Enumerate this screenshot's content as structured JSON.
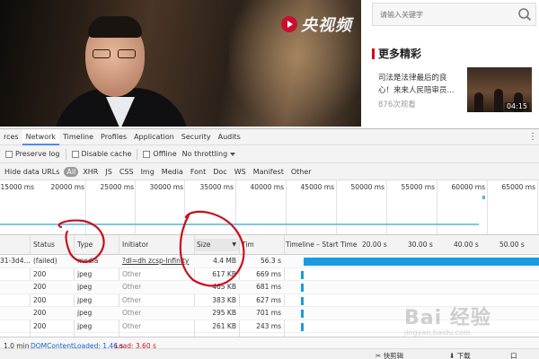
{
  "video": {
    "logo_text": "央视频"
  },
  "search": {
    "placeholder": "请输入关键字"
  },
  "recommend": {
    "section_title": "更多精彩",
    "item_title": "司法是法律最后的良心！来来人民陪审员...",
    "views": "876次观看",
    "duration": "04:15"
  },
  "devtools": {
    "tabs": [
      "rces",
      "Network",
      "Timeline",
      "Profiles",
      "Application",
      "Security",
      "Audits"
    ],
    "active_tab": "Network",
    "toolbar": {
      "preserve_log": "Preserve log",
      "disable_cache": "Disable cache",
      "offline": "Offline",
      "throttling": "No throttling"
    },
    "filters": [
      "Hide data URLs",
      "All",
      "XHR",
      "JS",
      "CSS",
      "Img",
      "Media",
      "Font",
      "Doc",
      "WS",
      "Manifest",
      "Other"
    ],
    "active_filter": "All",
    "overview_ticks": [
      "15000 ms",
      "20000 ms",
      "25000 ms",
      "30000 ms",
      "35000 ms",
      "40000 ms",
      "45000 ms",
      "50000 ms",
      "55000 ms",
      "60000 ms",
      "65000 ms"
    ],
    "columns": {
      "status": "Status",
      "type": "Type",
      "initiator": "Initiator",
      "size": "Size",
      "time": "Tim",
      "timeline": "Timeline – Start Time",
      "timeline_ticks": [
        "20.00 s",
        "30.00 s",
        "40.00 s",
        "50.00 s"
      ]
    },
    "rows": [
      {
        "name": "31-3d4...",
        "status": "(failed)",
        "type": "media",
        "initiator": "?dl=dh zcsp-Infinity",
        "size": "4.4 MB",
        "time": "56.3 s"
      },
      {
        "name": "",
        "status": "200",
        "type": "jpeg",
        "initiator": "Other",
        "size": "617 KB",
        "time": "669 ms"
      },
      {
        "name": "",
        "status": "200",
        "type": "jpeg",
        "initiator": "Other",
        "size": "465 KB",
        "time": "681 ms"
      },
      {
        "name": "",
        "status": "200",
        "type": "jpeg",
        "initiator": "Other",
        "size": "383 KB",
        "time": "627 ms"
      },
      {
        "name": "",
        "status": "200",
        "type": "jpeg",
        "initiator": "Other",
        "size": "295 KB",
        "time": "701 ms"
      },
      {
        "name": "",
        "status": "200",
        "type": "jpeg",
        "initiator": "Other",
        "size": "261 KB",
        "time": "243 ms"
      }
    ],
    "status_bar": {
      "finish": "1.0 min",
      "dom_content_loaded": "DOMContentLoaded: 1.46 s",
      "load": "Load: 3.60 s"
    },
    "bottom_strip": [
      "快剪辑",
      "下载",
      "口"
    ]
  },
  "watermark": {
    "text": "Bai 经验",
    "sub": "jingyan.baidu.com"
  },
  "colors": {
    "accent": "#1a9ae0",
    "dom_content_loaded": "#1a5fd0",
    "load": "#d0121b",
    "annotation": "#c8101e"
  }
}
